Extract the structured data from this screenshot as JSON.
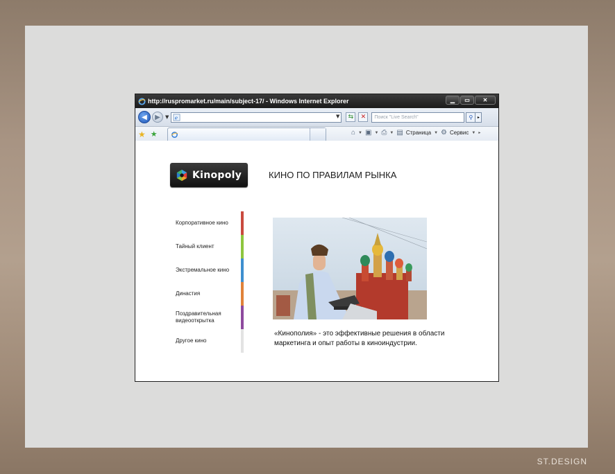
{
  "browser": {
    "title": "http://ruspromarket.ru/main/subject-17/ - Windows Internet Explorer",
    "search_placeholder": "Поиск \"Live Search\"",
    "toolbar": {
      "page_label": "Страница",
      "tools_label": "Сервис"
    }
  },
  "site": {
    "logo_text": "Kinopoly",
    "tagline": "КИНО ПО ПРАВИЛАМ РЫНКА",
    "menu": [
      {
        "label": "Корпоративное кино",
        "color": "#c94a3f"
      },
      {
        "label": "Тайный клиент",
        "color": "#8ec63f"
      },
      {
        "label": "Экстремальное кино",
        "color": "#3f8fcf"
      },
      {
        "label": "Династия",
        "color": "#e0823a"
      },
      {
        "label": "Поздравительная видеооткрытка",
        "color": "#8e4a9e"
      },
      {
        "label": "Другое кино",
        "color": "#e3e3e3"
      }
    ],
    "description": "«Кинополия» - это эффективные решения в области маркетинга и опыт работы в киноиндустрии."
  },
  "frame": {
    "brand": "ST.DESIGN"
  }
}
